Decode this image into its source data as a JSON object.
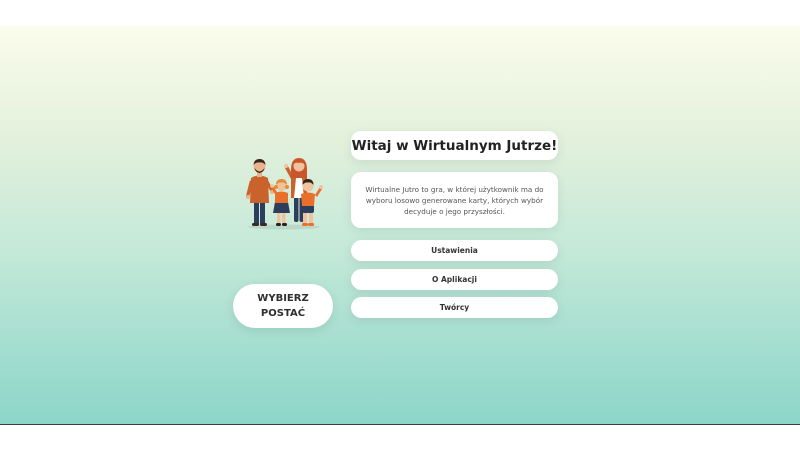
{
  "welcome": {
    "title": "Witaj w Wirtualnym Jutrze!",
    "description": "Wirtualne Jutro to gra, w której użytkownik ma do wyboru losowo generowane karty, których wybór decyduje o jego przyszłości."
  },
  "menu": {
    "items": [
      {
        "label": "Ustawienia"
      },
      {
        "label": "O Aplikacji"
      },
      {
        "label": "Twórcy"
      }
    ]
  },
  "choose_character": {
    "line1": "WYBIERZ",
    "line2": "POSTAĆ"
  },
  "illustration": {
    "icon": "family-illustration"
  },
  "colors": {
    "gradient_top": "#fbfcec",
    "gradient_bottom": "#8cd6c9",
    "card": "#ffffff",
    "accent_orange": "#e8702a"
  }
}
